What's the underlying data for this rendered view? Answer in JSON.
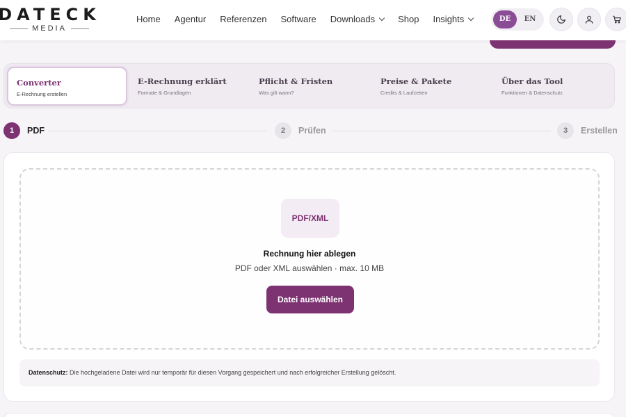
{
  "header": {
    "logo_main": "DATECK",
    "logo_sub": "MEDIA",
    "nav": [
      {
        "label": "Home"
      },
      {
        "label": "Agentur"
      },
      {
        "label": "Referenzen"
      },
      {
        "label": "Software"
      },
      {
        "label": "Downloads",
        "has_dropdown": true
      },
      {
        "label": "Shop"
      },
      {
        "label": "Insights",
        "has_dropdown": true
      }
    ],
    "lang": {
      "de": "DE",
      "en": "EN",
      "active": "DE"
    },
    "icons": [
      "moon-icon",
      "user-icon",
      "cart-icon"
    ]
  },
  "tabs": [
    {
      "title": "Converter",
      "sub": "E-Rechnung erstellen",
      "active": true
    },
    {
      "title": "E-Rechnung erklärt",
      "sub": "Formate & Grundlagen"
    },
    {
      "title": "Pflicht & Fristen",
      "sub": "Was gilt wann?"
    },
    {
      "title": "Preise & Pakete",
      "sub": "Credits & Laufzeiten"
    },
    {
      "title": "Über das Tool",
      "sub": "Funktionen & Datenschutz"
    }
  ],
  "steps": [
    {
      "num": "1",
      "label": "PDF",
      "active": true
    },
    {
      "num": "2",
      "label": "Prüfen"
    },
    {
      "num": "3",
      "label": "Erstellen"
    }
  ],
  "upload": {
    "badge": "PDF/XML",
    "title": "Rechnung hier ablegen",
    "subtitle": "PDF oder XML auswählen · max. 10 MB",
    "button": "Datei auswählen"
  },
  "privacy": {
    "label": "Datenschutz:",
    "text": " Die hochgeladene Datei wird nur temporär für diesen Vorgang gespeichert und nach erfolgreicher Erstellung gelöscht."
  },
  "colors": {
    "brand": "#7d3272",
    "lang_active": "#8b4c96"
  }
}
